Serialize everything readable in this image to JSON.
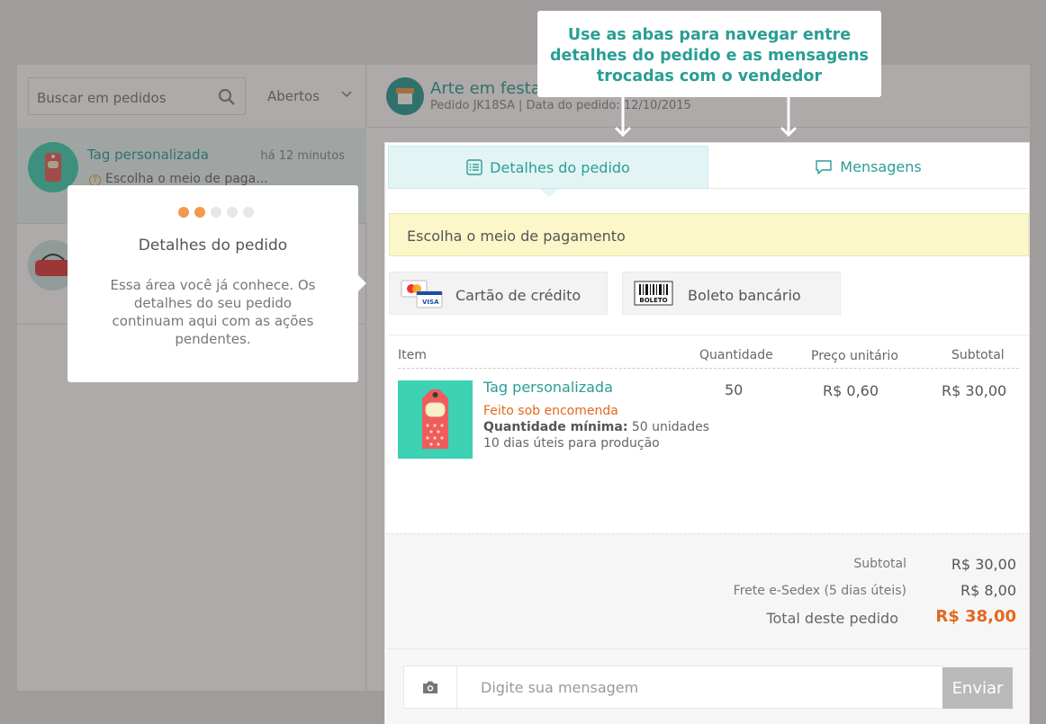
{
  "left_panel": {
    "search_placeholder": "Buscar em pedidos",
    "filter_label": "Abertos",
    "conversations": [
      {
        "title": "Tag personalizada",
        "time": "há 12 minutos",
        "status": "Escolha o meio de paga..."
      }
    ]
  },
  "order_header": {
    "shop_name": "Arte em festa",
    "subtitle": "Pedido JK18SA | Data do pedido: 12/10/2015"
  },
  "tabs": [
    {
      "label": "Detalhes do pedido"
    },
    {
      "label": "Mensagens"
    }
  ],
  "notice": "Escolha o meio de pagamento",
  "payment_methods": [
    {
      "label": "Cartão de crédito"
    },
    {
      "label": "Boleto bancário"
    }
  ],
  "boleto_icon_text": "BOLETO",
  "table": {
    "headers": [
      "Item",
      "Quantidade",
      "Preço unitário",
      "Subtotal"
    ],
    "rows": [
      {
        "name": "Tag personalizada",
        "made_to_order": "Feito sob encomenda",
        "min_qty_label": "Quantidade mínima:",
        "min_qty_value": "50 unidades",
        "production": "10 dias úteis para produção",
        "quantity": "50",
        "unit_price": "R$ 0,60",
        "subtotal": "R$ 30,00"
      }
    ]
  },
  "totals": {
    "subtotal_label": "Subtotal",
    "subtotal_value": "R$ 30,00",
    "shipping_label": "Frete e-Sedex (5 dias úteis)",
    "shipping_value": "R$ 8,00",
    "total_label": "Total deste pedido",
    "total_value": "R$ 38,00"
  },
  "message": {
    "placeholder": "Digite sua mensagem",
    "send_label": "Enviar"
  },
  "tooltip": {
    "step": 2,
    "steps_total": 5,
    "title": "Detalhes do pedido",
    "body": "Essa área você já conhece. Os detalhes do seu pedido continuam aqui com as ações pendentes."
  },
  "callout": {
    "text": "Use as abas para navegar entre detalhes do pedido e as mensagens trocadas com o vendedor"
  },
  "colors": {
    "accent": "#2a9e95",
    "highlight_orange": "#e3681e",
    "dot_active": "#f19a4f",
    "notice_bg": "#fbf7c9",
    "overlay": "#a09c9b"
  }
}
